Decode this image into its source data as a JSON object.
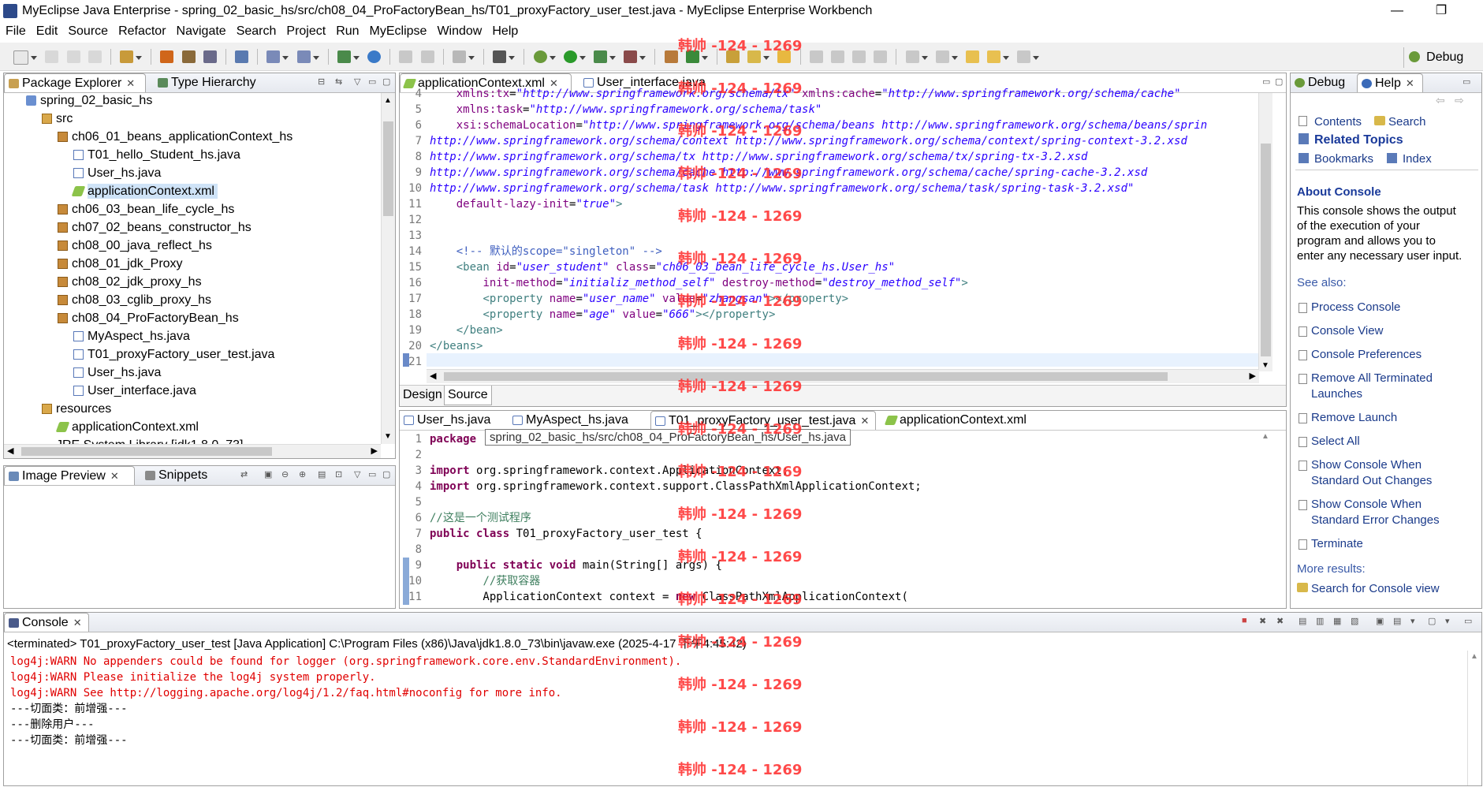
{
  "window": {
    "title": "MyEclipse Java Enterprise - spring_02_basic_hs/src/ch08_04_ProFactoryBean_hs/T01_proxyFactory_user_test.java - MyEclipse Enterprise Workbench",
    "minimize": "—",
    "restore": "❐"
  },
  "menu": [
    "File",
    "Edit",
    "Source",
    "Refactor",
    "Navigate",
    "Search",
    "Project",
    "Run",
    "MyEclipse",
    "Window",
    "Help"
  ],
  "perspective": {
    "label": "Debug"
  },
  "package_explorer": {
    "tabs": [
      {
        "label": "Package Explorer"
      },
      {
        "label": "Type Hierarchy"
      }
    ],
    "tree": [
      {
        "label": "spring_02_basic_hs",
        "icon": "project-icon"
      },
      {
        "label": "src",
        "icon": "source-folder-icon"
      },
      {
        "label": "ch06_01_beans_applicationContext_hs",
        "icon": "package-icon"
      },
      {
        "label": "T01_hello_Student_hs.java",
        "icon": "java-file-icon"
      },
      {
        "label": "User_hs.java",
        "icon": "java-file-icon"
      },
      {
        "label": "applicationContext.xml",
        "icon": "xml-file-icon"
      },
      {
        "label": "ch06_03_bean_life_cycle_hs",
        "icon": "package-icon"
      },
      {
        "label": "ch07_02_beans_constructor_hs",
        "icon": "package-icon"
      },
      {
        "label": "ch08_00_java_reflect_hs",
        "icon": "package-icon"
      },
      {
        "label": "ch08_01_jdk_Proxy",
        "icon": "package-icon"
      },
      {
        "label": "ch08_02_jdk_proxy_hs",
        "icon": "package-icon"
      },
      {
        "label": "ch08_03_cglib_proxy_hs",
        "icon": "package-icon"
      },
      {
        "label": "ch08_04_ProFactoryBean_hs",
        "icon": "package-icon"
      },
      {
        "label": "MyAspect_hs.java",
        "icon": "java-file-icon"
      },
      {
        "label": "T01_proxyFactory_user_test.java",
        "icon": "java-file-icon"
      },
      {
        "label": "User_hs.java",
        "icon": "java-file-icon"
      },
      {
        "label": "User_interface.java",
        "icon": "java-file-icon"
      },
      {
        "label": "resources",
        "icon": "source-folder-icon"
      },
      {
        "label": "applicationContext.xml",
        "icon": "xml-file-icon"
      },
      {
        "label": "JRE System Library [jdk1.8.0_73]",
        "icon": "library-icon"
      }
    ]
  },
  "image_preview": {
    "tabs": [
      {
        "label": "Image Preview"
      },
      {
        "label": "Snippets"
      }
    ]
  },
  "xml_editor": {
    "tabs": [
      {
        "label": "applicationContext.xml"
      },
      {
        "label": "User_interface.java"
      }
    ],
    "bottom_tabs": [
      "Design",
      "Source"
    ],
    "lines": [
      {
        "n": "4",
        "html": "    <span class='attr'>xmlns:tx</span>=<span class='str'>\"http://www.springframework.org/schema/tx\"</span> <span class='attr'>xmlns:cache</span>=<span class='str'>\"http://www.springframework.org/schema/cache\"</span>"
      },
      {
        "n": "5",
        "html": "    <span class='attr'>xmlns:task</span>=<span class='str'>\"http://www.springframework.org/schema/task\"</span>"
      },
      {
        "n": "6",
        "html": "    <span class='attr'>xsi:schemaLocation</span>=<span class='str'>\"http://www.springframework.org/schema/beans http://www.springframework.org/schema/beans/sprin</span>"
      },
      {
        "n": "7",
        "html": "<span class='str'>http://www.springframework.org/schema/context http://www.springframework.org/schema/context/spring-context-3.2.xsd</span>"
      },
      {
        "n": "8",
        "html": "<span class='str'>http://www.springframework.org/schema/tx http://www.springframework.org/schema/tx/spring-tx-3.2.xsd</span>"
      },
      {
        "n": "9",
        "html": "<span class='str'>http://www.springframework.org/schema/cache http://www.springframework.org/schema/cache/spring-cache-3.2.xsd</span>"
      },
      {
        "n": "10",
        "html": "<span class='str'>http://www.springframework.org/schema/task http://www.springframework.org/schema/task/spring-task-3.2.xsd\"</span>"
      },
      {
        "n": "11",
        "html": "    <span class='attr'>default-lazy-init</span>=<span class='str'>\"true\"</span><span class='tag'>&gt;</span>"
      },
      {
        "n": "12",
        "html": ""
      },
      {
        "n": "13",
        "html": ""
      },
      {
        "n": "14",
        "html": "    <span class='cmt'>&lt;!-- 默认的scope=\"singleton\" --&gt;</span>"
      },
      {
        "n": "15",
        "html": "    <span class='tag'>&lt;bean</span> <span class='attr'>id</span>=<span class='str'>\"user_student\"</span> <span class='attr'>class</span>=<span class='str'>\"ch06_03_bean_life_cycle_hs.User_hs\"</span>"
      },
      {
        "n": "16",
        "html": "        <span class='attr'>init-method</span>=<span class='str'>\"initializ_method_self\"</span> <span class='attr'>destroy-method</span>=<span class='str'>\"destroy_method_self\"</span><span class='tag'>&gt;</span>"
      },
      {
        "n": "17",
        "html": "        <span class='tag'>&lt;property</span> <span class='attr'>name</span>=<span class='str'>\"user_name\"</span> <span class='attr'>value</span>=<span class='str'>\"zhangsan\"</span><span class='tag'>&gt;&lt;/property&gt;</span>"
      },
      {
        "n": "18",
        "html": "        <span class='tag'>&lt;property</span> <span class='attr'>name</span>=<span class='str'>\"age\"</span> <span class='attr'>value</span>=<span class='str'>\"666\"</span><span class='tag'>&gt;&lt;/property&gt;</span>"
      },
      {
        "n": "19",
        "html": "    <span class='tag'>&lt;/bean&gt;</span>"
      },
      {
        "n": "20",
        "html": "<span class='tag'>&lt;/beans&gt;</span>"
      },
      {
        "n": "21",
        "html": ""
      }
    ]
  },
  "java_editor": {
    "tabs": [
      {
        "label": "User_hs.java"
      },
      {
        "label": "MyAspect_hs.java"
      },
      {
        "label": "T01_proxyFactory_user_test.java"
      },
      {
        "label": "applicationContext.xml"
      }
    ],
    "tooltip": "spring_02_basic_hs/src/ch08_04_ProFactoryBean_hs/User_hs.java",
    "lines": [
      {
        "n": "1",
        "html": "<span class='kw'>package</span>"
      },
      {
        "n": "2",
        "html": ""
      },
      {
        "n": "3",
        "html": "<span class='kw'>import</span> org.springframework.context.ApplicationContext;"
      },
      {
        "n": "4",
        "html": "<span class='kw'>import</span> org.springframework.context.support.ClassPathXmlApplicationContext;"
      },
      {
        "n": "5",
        "html": ""
      },
      {
        "n": "6",
        "html": "<span class='jcmt'>//这是一个测试程序</span>"
      },
      {
        "n": "7",
        "html": "<span class='kw'>public class</span> T01_proxyFactory_user_test {"
      },
      {
        "n": "8",
        "html": ""
      },
      {
        "n": "9",
        "html": "    <span class='kw'>public static void</span> main(String[] args) {"
      },
      {
        "n": "10",
        "html": "        <span class='jcmt'>//获取容器</span>"
      },
      {
        "n": "11",
        "html": "        ApplicationContext context = <span class='kw'>new</span> ClassPathXmlApplicationContext("
      }
    ]
  },
  "help": {
    "tabs": [
      {
        "label": "Debug"
      },
      {
        "label": "Help"
      }
    ],
    "contents": "Contents",
    "search": "Search",
    "related_topics": "Related Topics",
    "bookmarks": "Bookmarks",
    "index": "Index",
    "about_title": "About Console",
    "about_lines": [
      "This console shows the output",
      "of the execution of your",
      "program and allows you to",
      "enter any necessary user input."
    ],
    "see_also": "See also:",
    "links": [
      {
        "lines": [
          "Process Console"
        ]
      },
      {
        "lines": [
          "Console View"
        ]
      },
      {
        "lines": [
          "Console Preferences"
        ]
      },
      {
        "lines": [
          "Remove All Terminated",
          "Launches"
        ]
      },
      {
        "lines": [
          "Remove Launch"
        ]
      },
      {
        "lines": [
          "Select All"
        ]
      },
      {
        "lines": [
          "Show Console When",
          "Standard Out Changes"
        ]
      },
      {
        "lines": [
          "Show Console When",
          "Standard Error Changes"
        ]
      },
      {
        "lines": [
          "Terminate"
        ]
      }
    ],
    "more_results": "More results:",
    "search_console": "Search for Console view"
  },
  "console": {
    "tab": "Console",
    "status": "<terminated> T01_proxyFactory_user_test [Java Application] C:\\Program Files (x86)\\Java\\jdk1.8.0_73\\bin\\javaw.exe (2025-4-17 下午4:45:42)",
    "lines": [
      {
        "text": "log4j:WARN No appenders could be found for logger (org.springframework.core.env.StandardEnvironment).",
        "level": "warn"
      },
      {
        "text": "log4j:WARN Please initialize the log4j system properly.",
        "level": "warn"
      },
      {
        "text": "log4j:WARN See http://logging.apache.org/log4j/1.2/faq.html#noconfig for more info.",
        "level": "warn"
      },
      {
        "text": "---切面类：前增强---",
        "level": "out"
      },
      {
        "text": "---删除用户---",
        "level": "out"
      },
      {
        "text": "---切面类：前增强---",
        "level": "out"
      }
    ]
  },
  "watermark": "韩帅 -124 - 1269"
}
